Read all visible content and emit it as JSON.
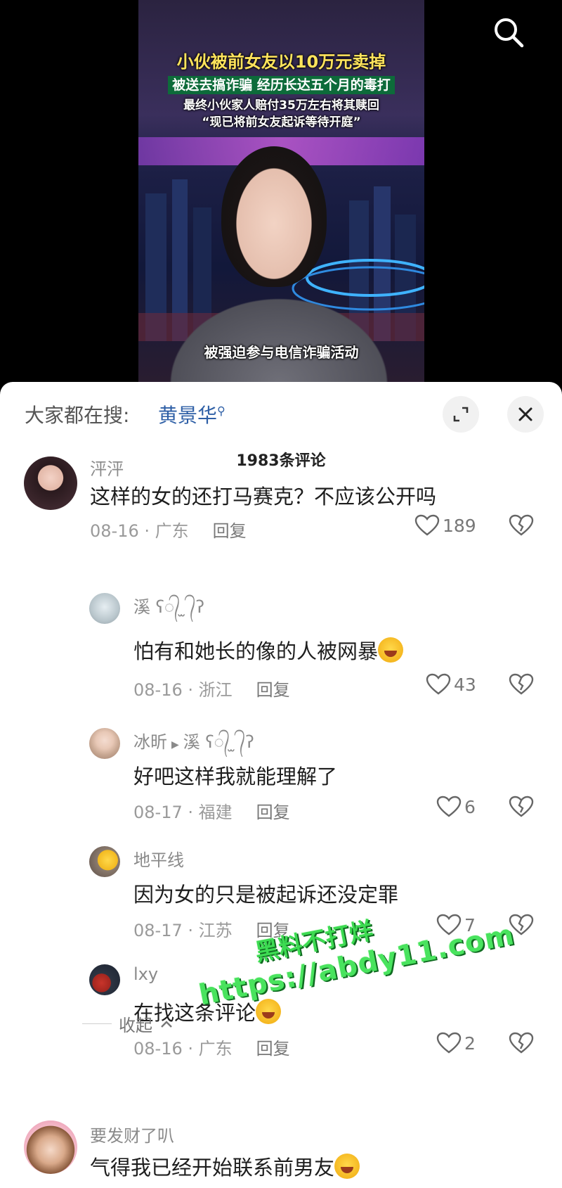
{
  "video": {
    "headline_1": "小伙被前女友以10万元卖掉",
    "headline_2": "被送去搞诈骗 经历长达五个月的毒打",
    "headline_3a": "最终小伙家人赔付35万左右将其赎回",
    "headline_3b": "“现已将前女友起诉等待开庭”",
    "subtitle": "被强迫参与电信诈骗活动",
    "search_icon": "search-icon"
  },
  "sheet": {
    "trend_label": "大家都在搜:",
    "trend_term": "黄景华",
    "expand_icon": "expand-icon",
    "close_icon": "close-icon",
    "comment_count": "1983条评论"
  },
  "comments": [
    {
      "author": "泙泙",
      "text": "这样的女的还打马赛克？不应该公开吗",
      "date": "08-16 · 广东",
      "reply": "回复",
      "likes": "189"
    },
    {
      "author": "溪 ʕ᭄ ̫ ᭄ʔ",
      "text": "怕有和她长的像的人被网暴",
      "date": "08-16 · 浙江",
      "reply": "回复",
      "likes": "43"
    },
    {
      "author": "冰昕",
      "reply_to": "溪 ʕ᭄ ̫ ᭄ʔ",
      "text": "好吧这样我就能理解了",
      "date": "08-17 · 福建",
      "reply": "回复",
      "likes": "6"
    },
    {
      "author": "地平线",
      "text": "因为女的只是被起诉还没定罪",
      "date": "08-17 · 江苏",
      "reply": "回复",
      "likes": "7"
    },
    {
      "author": "lxy",
      "text": "在找这条评论",
      "date": "08-16 · 广东",
      "reply": "回复",
      "likes": "2"
    },
    {
      "author": "要发财了叭",
      "text": "气得我已经开始联系前男友"
    }
  ],
  "collapse_label": "收起",
  "watermark": {
    "line1": "黑料不打烊",
    "line2": "https://abdy11.com"
  },
  "colors": {
    "accent": "#2e5fa6",
    "watermark": "#3ddb52"
  }
}
